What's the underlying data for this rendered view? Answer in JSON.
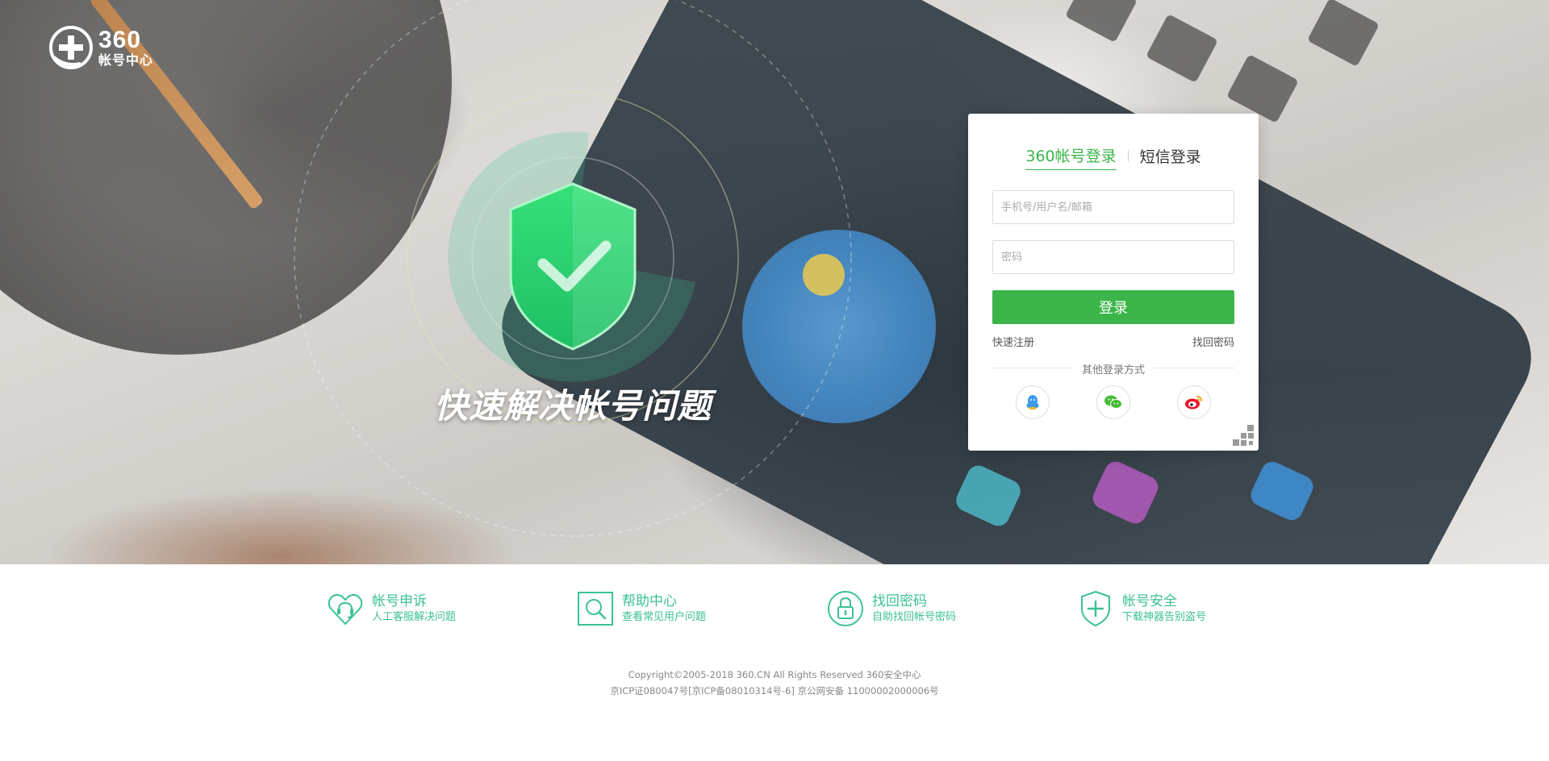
{
  "logo": {
    "number": "360",
    "subtitle": "帐号中心"
  },
  "hero": {
    "slogan": "快速解决帐号问题"
  },
  "login": {
    "tabs": [
      {
        "label": "360帐号登录",
        "active": true
      },
      {
        "label": "短信登录",
        "active": false
      }
    ],
    "username_placeholder": "手机号/用户名/邮箱",
    "password_placeholder": "密码",
    "submit_label": "登录",
    "register_link": "快速注册",
    "forgot_link": "找回密码",
    "other_methods_label": "其他登录方式",
    "social_icons": [
      "qq-icon",
      "wechat-icon",
      "weibo-icon"
    ]
  },
  "features": [
    {
      "title": "帐号申诉",
      "subtitle": "人工客服解决问题",
      "icon": "heart-headset-icon"
    },
    {
      "title": "帮助中心",
      "subtitle": "查看常见用户问题",
      "icon": "search-icon"
    },
    {
      "title": "找回密码",
      "subtitle": "自助找回帐号密码",
      "icon": "lock-icon"
    },
    {
      "title": "帐号安全",
      "subtitle": "下载神器告别盗号",
      "icon": "shield-plus-icon"
    }
  ],
  "footer": {
    "copyright": "Copyright©2005-2018 360.CN All Rights Reserved 360安全中心",
    "icp": "京ICP证080047号[京ICP备08010314号-6] 京公网安备 11000002000006号"
  },
  "colors": {
    "brand_green": "#3bb54a",
    "feature_teal": "#3cc291"
  }
}
